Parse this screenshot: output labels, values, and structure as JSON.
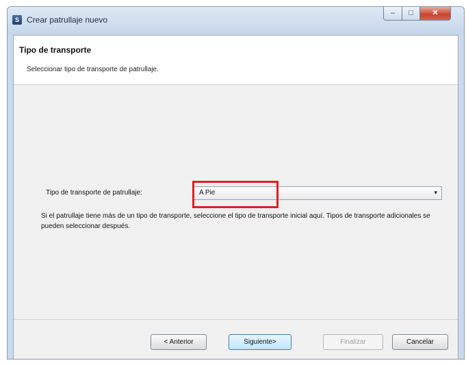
{
  "window": {
    "title": "Crear patrullaje nuevo",
    "app_icon": "app-logo-icon",
    "controls": {
      "minimize": "–",
      "maximize": "□",
      "close": "✕"
    }
  },
  "header": {
    "title": "Tipo de transporte",
    "subtitle": "Seleccionar tipo de transporte de patrullaje."
  },
  "form": {
    "transport_label": "Tipo de transporte de patrullaje:",
    "transport_value": "A Pie",
    "dropdown_arrow": "▾",
    "help_text": "Si el patrullaje tiene más de un tipo de transporte, seleccione el tipo de transporte inicial aquí. Tipos de transporte adicionales se pueden seleccionar después."
  },
  "buttons": {
    "back": "< Anterior",
    "next": "Siguiente>",
    "finish": "Finalizar",
    "cancel": "Cancelar"
  },
  "colors": {
    "highlight": "#e02020",
    "window_frame": "#c9d9ee"
  }
}
